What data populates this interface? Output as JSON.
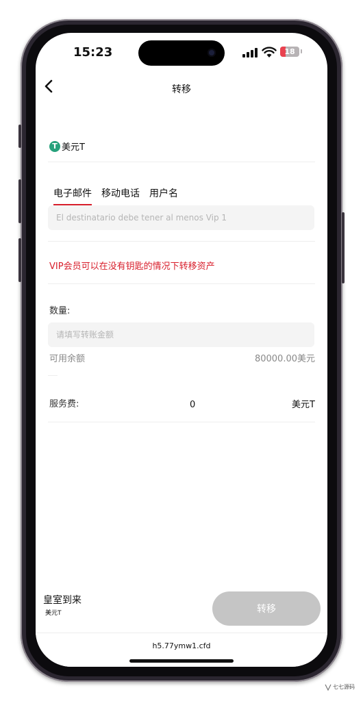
{
  "status": {
    "time": "15:23",
    "battery": "18"
  },
  "header": {
    "title": "转移"
  },
  "asset": {
    "name": "美元T",
    "icon": "tether-icon",
    "icon_glyph": "T"
  },
  "tabs": [
    {
      "label": "电子邮件",
      "active": true
    },
    {
      "label": "移动电话",
      "active": false
    },
    {
      "label": "用户名",
      "active": false
    }
  ],
  "recipient": {
    "placeholder": "El destinatario debe tener al menos Vip 1",
    "value": ""
  },
  "vip_note": "VIP会员可以在没有钥匙的情况下转移资产",
  "amount": {
    "label": "数量:",
    "placeholder": "请填写转账金额",
    "value": ""
  },
  "balance": {
    "label": "可用余额",
    "value": "80000.00美元"
  },
  "fee": {
    "label": "服务费:",
    "value": "0",
    "unit": "美元T"
  },
  "footer": {
    "name": "皇室到来",
    "asset": "美元T",
    "submit_label": "转移"
  },
  "browser": {
    "url": "h5.77ymw1.cfd"
  },
  "watermark": "七七源码",
  "colors": {
    "accent": "#d81e2b",
    "tether": "#26a17b",
    "button_disabled": "#c5c5c5",
    "input_bg": "#f4f4f4"
  }
}
